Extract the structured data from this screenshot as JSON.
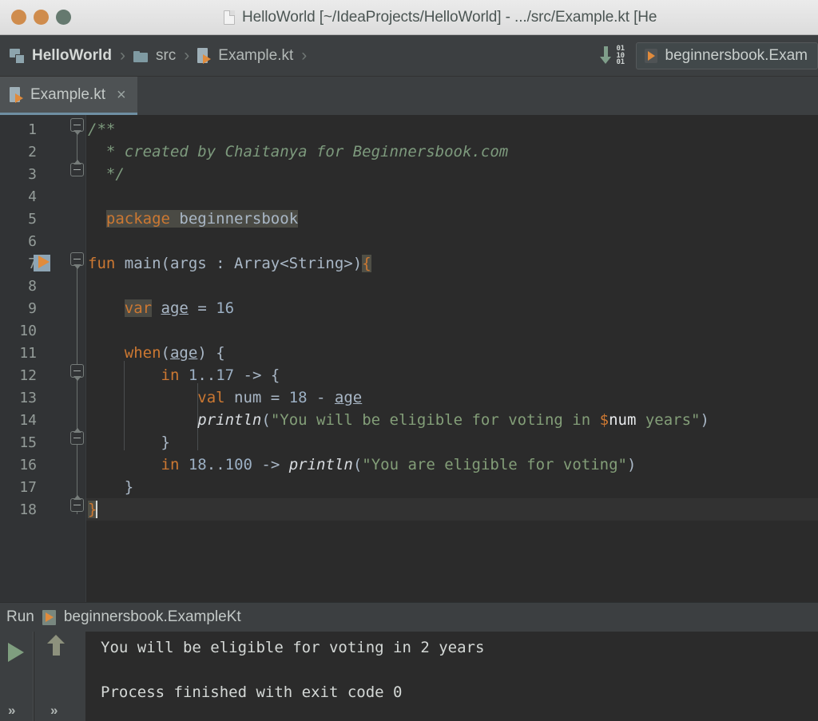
{
  "window": {
    "title": "HelloWorld [~/IdeaProjects/HelloWorld] - .../src/Example.kt [He",
    "traffic_lights": [
      "close",
      "minimize",
      "maximize"
    ],
    "colors": {
      "close": "#cf8c4d",
      "minimize": "#cf8c4d",
      "maximize": "#65796f",
      "titlebar_bg": "#e4e4e4",
      "chrome_bg": "#3c3f41",
      "editor_bg": "#2b2b2b",
      "gutter_bg": "#313335",
      "accent_orange": "#cc7832",
      "string_green": "#839e78",
      "comment_green": "#7d9a7d",
      "tab_underline": "#6f8fa3"
    }
  },
  "navbar": {
    "breadcrumbs": [
      {
        "label": "HelloWorld",
        "icon": "project-icon"
      },
      {
        "label": "src",
        "icon": "folder-icon"
      },
      {
        "label": "Example.kt",
        "icon": "kotlin-file-icon"
      }
    ],
    "separator": "›",
    "download_icon_digits": [
      "01",
      "10",
      "01"
    ],
    "run_configuration": "beginnersbook.Exam"
  },
  "tabs": [
    {
      "label": "Example.kt",
      "icon": "kotlin-file-icon",
      "close": "×",
      "active": true
    }
  ],
  "editor": {
    "line_numbers": [
      1,
      2,
      3,
      4,
      5,
      6,
      7,
      8,
      9,
      10,
      11,
      12,
      13,
      14,
      15,
      16,
      17,
      18
    ],
    "current_line": 18,
    "gutter_run_icon_line": 7,
    "lines": [
      {
        "n": 1,
        "tokens": [
          {
            "t": "/**",
            "c": "t-cmt"
          }
        ]
      },
      {
        "n": 2,
        "tokens": [
          {
            "t": "  * created by Chaitanya for Beginnersbook.com",
            "c": "t-cmt"
          }
        ]
      },
      {
        "n": 3,
        "tokens": [
          {
            "t": "  */",
            "c": "t-cmt"
          }
        ]
      },
      {
        "n": 4,
        "tokens": []
      },
      {
        "n": 5,
        "tokens": [
          {
            "t": "  ",
            "c": "t-txt"
          },
          {
            "t": "package",
            "c": "t-kw-hl"
          },
          {
            "t": " ",
            "c": "t-txt-hl"
          },
          {
            "t": "beginnersbook",
            "c": "t-txt-hl"
          }
        ]
      },
      {
        "n": 6,
        "tokens": []
      },
      {
        "n": 7,
        "tokens": [
          {
            "t": "fun ",
            "c": "t-kw"
          },
          {
            "t": "main",
            "c": "t-txt"
          },
          {
            "t": "(args : Array<String>)",
            "c": "t-txt"
          },
          {
            "t": "{",
            "c": "t-brace-hl"
          }
        ]
      },
      {
        "n": 8,
        "tokens": []
      },
      {
        "n": 9,
        "tokens": [
          {
            "t": "    ",
            "c": "t-txt"
          },
          {
            "t": "var",
            "c": "t-kw-hl"
          },
          {
            "t": " ",
            "c": "t-txt"
          },
          {
            "t": "age",
            "c": "t-var"
          },
          {
            "t": " = ",
            "c": "t-txt"
          },
          {
            "t": "16",
            "c": "t-num"
          }
        ]
      },
      {
        "n": 10,
        "tokens": []
      },
      {
        "n": 11,
        "tokens": [
          {
            "t": "    ",
            "c": "t-txt"
          },
          {
            "t": "when",
            "c": "t-kw"
          },
          {
            "t": "(",
            "c": "t-txt"
          },
          {
            "t": "age",
            "c": "t-var"
          },
          {
            "t": ") {",
            "c": "t-txt"
          }
        ]
      },
      {
        "n": 12,
        "tokens": [
          {
            "t": "        ",
            "c": "t-txt"
          },
          {
            "t": "in",
            "c": "t-kw"
          },
          {
            "t": " ",
            "c": "t-txt"
          },
          {
            "t": "1",
            "c": "t-num"
          },
          {
            "t": "..",
            "c": "t-txt"
          },
          {
            "t": "17",
            "c": "t-num"
          },
          {
            "t": " -> {",
            "c": "t-txt"
          }
        ]
      },
      {
        "n": 13,
        "tokens": [
          {
            "t": "            ",
            "c": "t-txt"
          },
          {
            "t": "val",
            "c": "t-kw"
          },
          {
            "t": " num = ",
            "c": "t-txt"
          },
          {
            "t": "18",
            "c": "t-num"
          },
          {
            "t": " - ",
            "c": "t-txt"
          },
          {
            "t": "age",
            "c": "t-var"
          }
        ]
      },
      {
        "n": 14,
        "tokens": [
          {
            "t": "            ",
            "c": "t-txt"
          },
          {
            "t": "println",
            "c": "t-fn"
          },
          {
            "t": "(",
            "c": "t-txt"
          },
          {
            "t": "\"You will be eligible for voting in ",
            "c": "t-str"
          },
          {
            "t": "$",
            "c": "t-dollar"
          },
          {
            "t": "num",
            "c": "t-tmpl"
          },
          {
            "t": " years\"",
            "c": "t-str"
          },
          {
            "t": ")",
            "c": "t-txt"
          }
        ]
      },
      {
        "n": 15,
        "tokens": [
          {
            "t": "        }",
            "c": "t-txt"
          }
        ]
      },
      {
        "n": 16,
        "tokens": [
          {
            "t": "        ",
            "c": "t-txt"
          },
          {
            "t": "in",
            "c": "t-kw"
          },
          {
            "t": " ",
            "c": "t-txt"
          },
          {
            "t": "18",
            "c": "t-num"
          },
          {
            "t": "..",
            "c": "t-txt"
          },
          {
            "t": "100",
            "c": "t-num"
          },
          {
            "t": " -> ",
            "c": "t-txt"
          },
          {
            "t": "println",
            "c": "t-fn"
          },
          {
            "t": "(",
            "c": "t-txt"
          },
          {
            "t": "\"You are eligible for voting\"",
            "c": "t-str"
          },
          {
            "t": ")",
            "c": "t-txt"
          }
        ]
      },
      {
        "n": 17,
        "tokens": [
          {
            "t": "    }",
            "c": "t-txt"
          }
        ]
      },
      {
        "n": 18,
        "tokens": [
          {
            "t": "}",
            "c": "t-brace-hl"
          }
        ]
      }
    ]
  },
  "run_panel": {
    "label": "Run",
    "configuration": "beginnersbook.ExampleKt",
    "toolbar": {
      "run_icon": "play-icon",
      "rerun_icon": "rerun-up-arrow-icon",
      "expand_left": "»",
      "expand_right": "»"
    },
    "console_output": [
      "You will be eligible for voting in 2 years",
      "",
      "Process finished with exit code 0"
    ]
  }
}
